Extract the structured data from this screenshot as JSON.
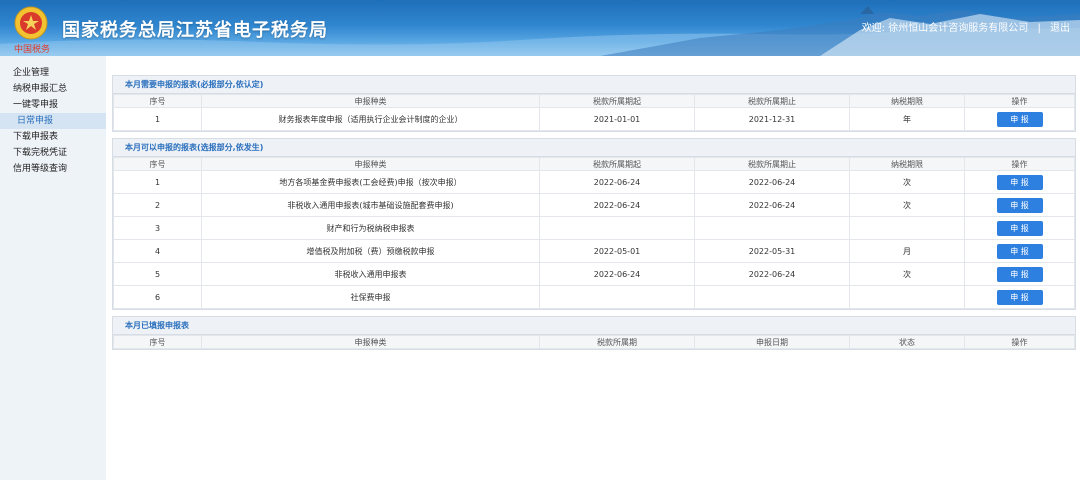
{
  "header": {
    "title": "国家税务总局江苏省电子税务局",
    "brand_sub": "中国税务",
    "welcome": "欢迎: 徐州恒山会计咨询服务有限公司",
    "separator": "|",
    "logout": "退出"
  },
  "sidebar": {
    "items": [
      {
        "label": "企业管理"
      },
      {
        "label": "纳税申报汇总"
      },
      {
        "label": "一键零申报"
      },
      {
        "label": "日常申报"
      },
      {
        "label": "下载申报表"
      },
      {
        "label": "下载完税凭证"
      },
      {
        "label": "信用等级查询"
      }
    ]
  },
  "section1": {
    "title": "本月需要申报的报表(必报部分,依认定)",
    "headers": [
      "序号",
      "申报种类",
      "税款所属期起",
      "税款所属期止",
      "纳税期限",
      "操作"
    ],
    "rows": [
      {
        "no": "1",
        "type": "财务报表年度申报（适用执行企业会计制度的企业）",
        "start": "2021-01-01",
        "end": "2021-12-31",
        "period": "年",
        "action": "申 报"
      }
    ]
  },
  "section2": {
    "title": "本月可以申报的报表(选报部分,依发生)",
    "headers": [
      "序号",
      "申报种类",
      "税款所属期起",
      "税款所属期止",
      "纳税期限",
      "操作"
    ],
    "rows": [
      {
        "no": "1",
        "type": "地方各项基金费申报表(工会经费)申报（按次申报）",
        "start": "2022-06-24",
        "end": "2022-06-24",
        "period": "次",
        "action": "申 报"
      },
      {
        "no": "2",
        "type": "非税收入通用申报表(城市基础设施配套费申报)",
        "start": "2022-06-24",
        "end": "2022-06-24",
        "period": "次",
        "action": "申 报"
      },
      {
        "no": "3",
        "type": "财产和行为税纳税申报表",
        "start": "",
        "end": "",
        "period": "",
        "action": "申 报"
      },
      {
        "no": "4",
        "type": "增值税及附加税（费）预缴税款申报",
        "start": "2022-05-01",
        "end": "2022-05-31",
        "period": "月",
        "action": "申 报"
      },
      {
        "no": "5",
        "type": "非税收入通用申报表",
        "start": "2022-06-24",
        "end": "2022-06-24",
        "period": "次",
        "action": "申 报"
      },
      {
        "no": "6",
        "type": "社保费申报",
        "start": "",
        "end": "",
        "period": "",
        "action": "申 报"
      }
    ]
  },
  "section3": {
    "title": "本月已填报申报表",
    "headers": [
      "序号",
      "申报种类",
      "税款所属期",
      "申报日期",
      "状态",
      "操作"
    ]
  }
}
